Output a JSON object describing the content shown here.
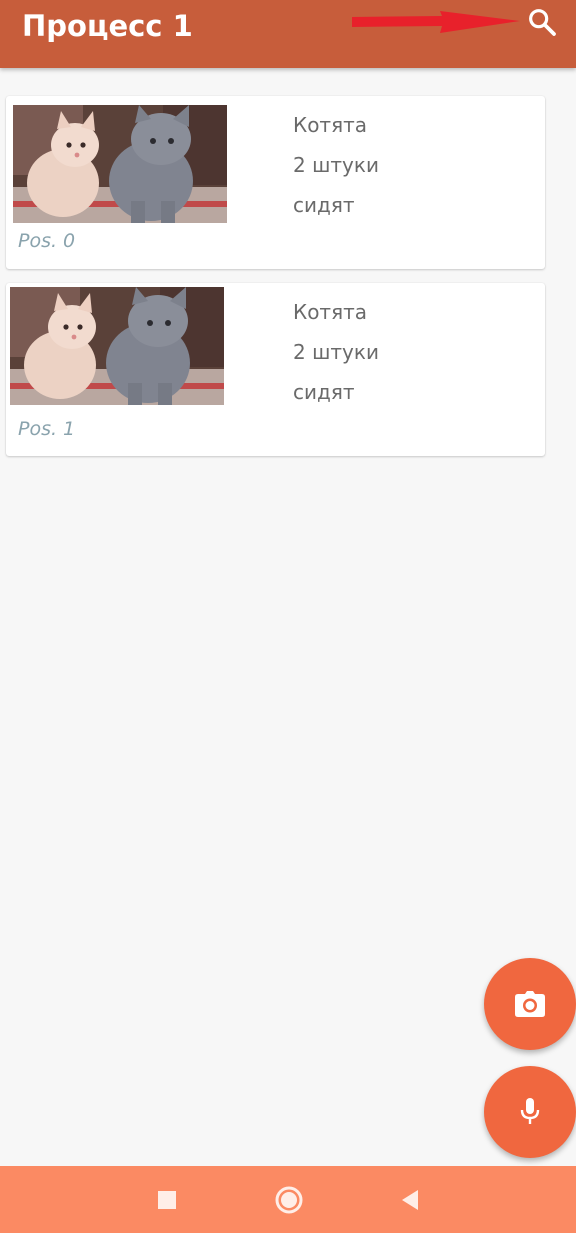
{
  "appbar": {
    "title": "Процесс 1",
    "color": "#c75d3b",
    "search_icon": "search-icon"
  },
  "annotation": {
    "arrow_color": "#e8212b",
    "arrow_icon": "red-arrow-icon"
  },
  "list": {
    "items": [
      {
        "image": "kittens-photo",
        "line1": "Котята",
        "line2": "2 штуки",
        "line3": "сидят",
        "pos": "Pos. 0"
      },
      {
        "image": "kittens-photo",
        "line1": "Котята",
        "line2": "2 штуки",
        "line3": "сидят",
        "pos": "Pos. 1"
      }
    ]
  },
  "fabs": {
    "camera_icon": "camera-icon",
    "mic_icon": "microphone-icon",
    "color": "#f0673f"
  },
  "navbar": {
    "color": "#fb8a63",
    "icons": [
      "recent-apps-icon",
      "home-icon",
      "back-icon"
    ]
  }
}
